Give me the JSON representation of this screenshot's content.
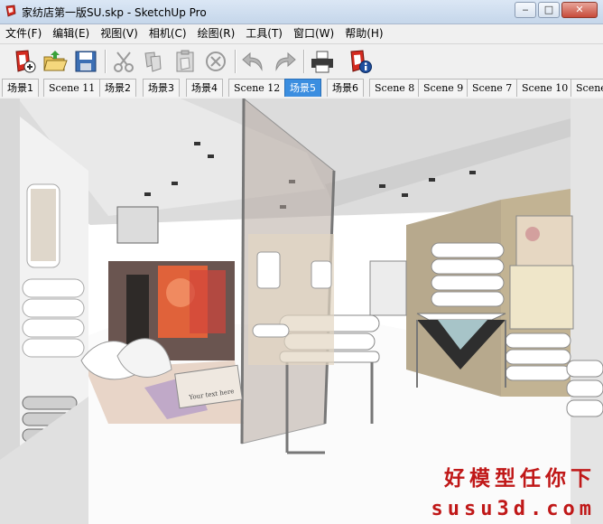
{
  "window": {
    "title": "家纺店第一版SU.skp - SketchUp Pro",
    "minimize_label": "‒",
    "maximize_label": "□",
    "close_label": "✕"
  },
  "menu": [
    "文件(F)",
    "编辑(E)",
    "视图(V)",
    "相机(C)",
    "绘图(R)",
    "工具(T)",
    "窗口(W)",
    "帮助(H)"
  ],
  "toolbar": {
    "buttons": [
      "new-file",
      "open-file",
      "save-file",
      "cut",
      "copy",
      "paste",
      "erase",
      "undo",
      "redo",
      "print",
      "model-info"
    ]
  },
  "scenes": {
    "tabs": [
      "场景1",
      "Scene 11",
      "场景2",
      "场景3",
      "场景4",
      "Scene 12",
      "场景5",
      "场景6",
      "Scene 8",
      "Scene 9",
      "Scene 7",
      "Scene 10",
      "Scene"
    ],
    "active_index": 6
  },
  "viewport": {
    "poster_text": "Your text here",
    "watermark_line1": "好模型任你下",
    "watermark_line2": "susu3d.com"
  },
  "colors": {
    "active_tab": "#3b8ee0",
    "watermark": "#c01818"
  }
}
